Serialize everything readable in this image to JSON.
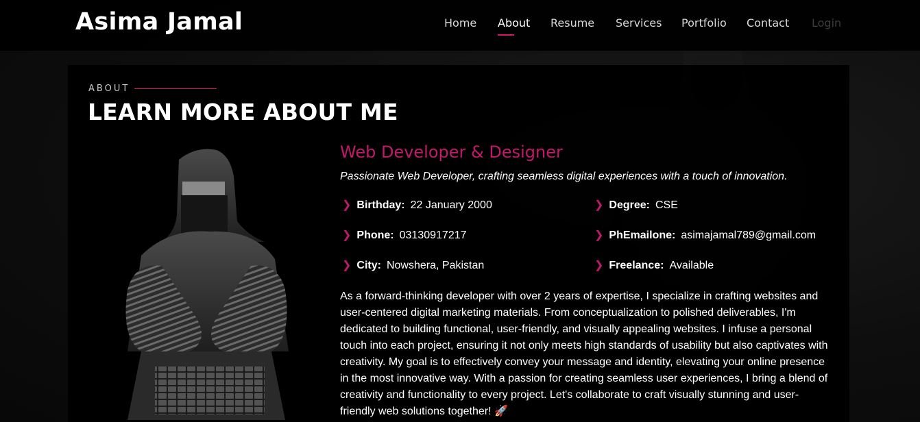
{
  "brand": {
    "name": "Asima Jamal"
  },
  "nav": {
    "items": [
      {
        "label": "Home"
      },
      {
        "label": "About"
      },
      {
        "label": "Resume"
      },
      {
        "label": "Services"
      },
      {
        "label": "Portfolio"
      },
      {
        "label": "Contact"
      },
      {
        "label": "Login"
      }
    ],
    "active": "About"
  },
  "about": {
    "tag": "ABOUT",
    "title": "LEARN MORE ABOUT ME",
    "role": "Web Developer & Designer",
    "tagline": "Passionate Web Developer, crafting seamless digital experiences with a touch of innovation.",
    "info": [
      {
        "label": "Birthday:",
        "value": "22 January 2000"
      },
      {
        "label": "Degree:",
        "value": "CSE"
      },
      {
        "label": "Phone:",
        "value": "03130917217"
      },
      {
        "label": "PhEmailone:",
        "value": "asimajamal789@gmail.com"
      },
      {
        "label": "City:",
        "value": "Nowshera, Pakistan"
      },
      {
        "label": "Freelance:",
        "value": "Available"
      }
    ],
    "bio": "As a forward-thinking developer with over 2 years of expertise, I specialize in crafting websites and user-centered digital marketing materials. From conceptualization to polished deliverables, I'm dedicated to building functional, user-friendly, and visually appealing websites. I infuse a personal touch into each project, ensuring it not only meets high standards of usability but also captivates with creativity. My goal is to effectively convey your message and identity, elevating your online presence in the most innovative way. With a passion for creating seamless user experiences, I bring a blend of creativity and functionality to every project. Let's collaborate to craft visually stunning and user-friendly web solutions together! 🚀"
  },
  "colors": {
    "accent": "#c3196b",
    "header_bg": "#000000",
    "panel_bg": "#000000"
  }
}
